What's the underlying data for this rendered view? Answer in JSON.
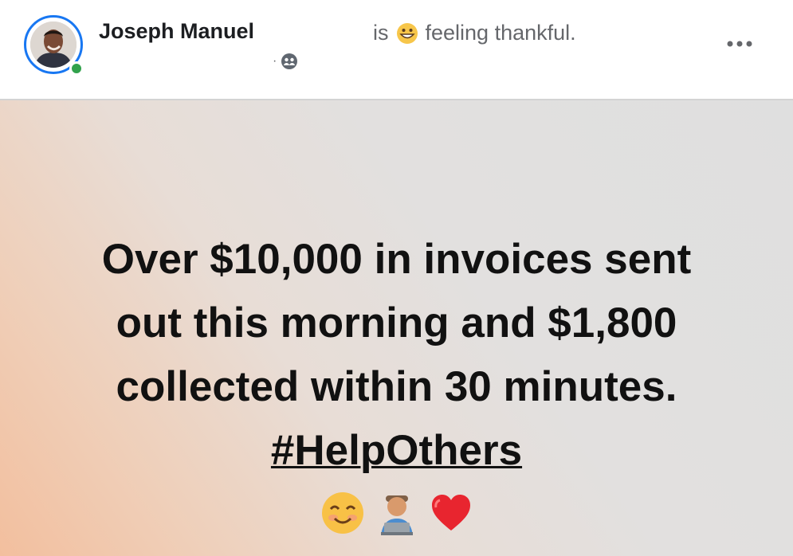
{
  "author": {
    "name": "Joseph Manuel"
  },
  "feeling": {
    "prefix": "is",
    "text": "feeling thankful.",
    "emoji_icon": "grinning-face-icon"
  },
  "meta": {
    "separator": "·",
    "audience_icon": "friends-icon"
  },
  "menu": {
    "icon": "more-options-icon",
    "label": "•••"
  },
  "post": {
    "lines": [
      "Over $10,000 in invoices sent",
      "out this morning and $1,800",
      "collected within 30 minutes."
    ],
    "hashtag": "#HelpOthers",
    "emojis": [
      "smiling-face-icon",
      "technologist-icon",
      "red-heart-icon"
    ]
  },
  "colors": {
    "accent": "#1877f2",
    "online": "#31a24c",
    "background_start": "#f3bf9e",
    "background_end": "#dfdfdf"
  }
}
